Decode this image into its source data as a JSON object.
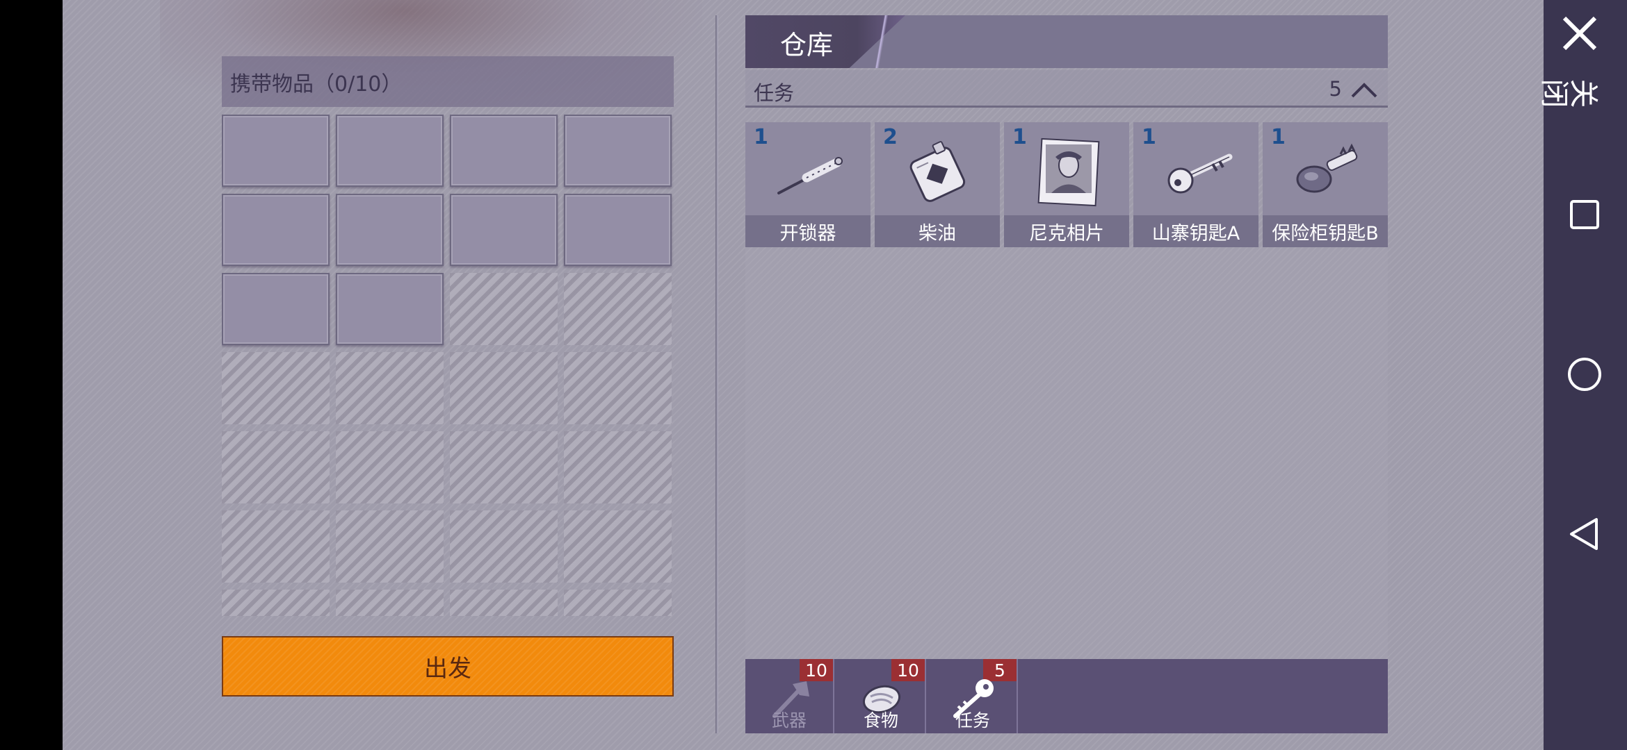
{
  "carry": {
    "header": "携带物品（0/10）",
    "depart_label": "出发",
    "slots_unlocked": 10,
    "slots_total": 28
  },
  "warehouse": {
    "title": "仓库",
    "category": {
      "label": "任务",
      "count": "5"
    },
    "items": [
      {
        "qty": "1",
        "name": "开锁器",
        "icon": "lockpick-icon"
      },
      {
        "qty": "2",
        "name": "柴油",
        "icon": "diesel-jerrycan-icon"
      },
      {
        "qty": "1",
        "name": "尼克相片",
        "icon": "photo-portrait-icon"
      },
      {
        "qty": "1",
        "name": "山寨钥匙A",
        "icon": "key-icon"
      },
      {
        "qty": "1",
        "name": "保险柜钥匙B",
        "icon": "safe-key-icon"
      }
    ],
    "tabs": [
      {
        "label": "武器",
        "badge": "10",
        "icon": "axe-icon"
      },
      {
        "label": "食物",
        "badge": "10",
        "icon": "meat-icon"
      },
      {
        "label": "任务",
        "badge": "5",
        "icon": "key-icon"
      }
    ]
  },
  "system": {
    "close_label": "关闭",
    "colors": {
      "accent_orange": "#f28a0c",
      "badge_red": "#9b2f33",
      "qty_blue": "#1e4f8e"
    }
  }
}
